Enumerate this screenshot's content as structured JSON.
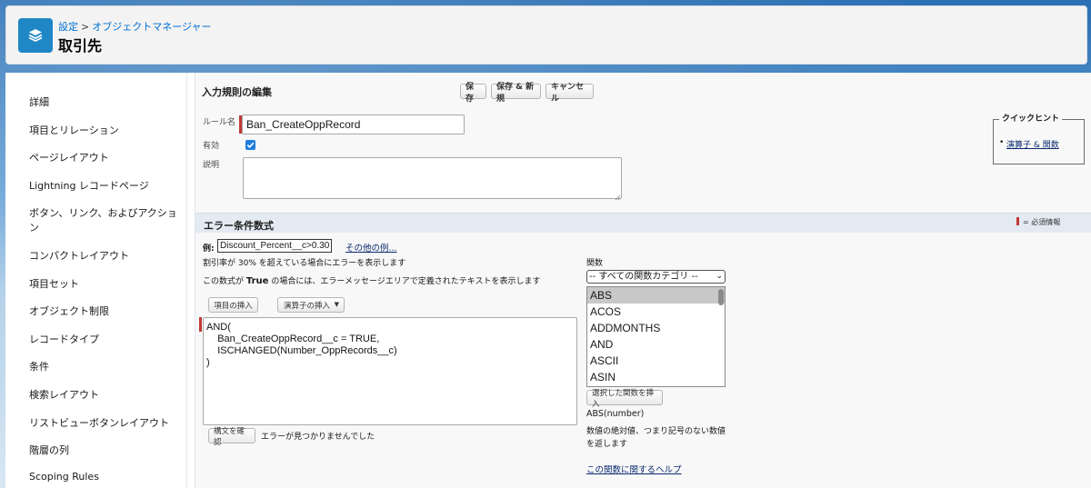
{
  "header": {
    "breadcrumb_root": "設定",
    "breadcrumb_sep": ">",
    "breadcrumb_child": "オブジェクトマネージャー",
    "title": "取引先"
  },
  "sidebar": {
    "items": [
      {
        "label": "詳細"
      },
      {
        "label": "項目とリレーション"
      },
      {
        "label": "ページレイアウト"
      },
      {
        "label": "Lightning レコードページ"
      },
      {
        "label": "ボタン、リンク、およびアクション"
      },
      {
        "label": "コンパクトレイアウト"
      },
      {
        "label": "項目セット"
      },
      {
        "label": "オブジェクト制限"
      },
      {
        "label": "レコードタイプ"
      },
      {
        "label": "条件"
      },
      {
        "label": "検索レイアウト"
      },
      {
        "label": "リストビューボタンレイアウト"
      },
      {
        "label": "階層の列"
      },
      {
        "label": "Scoping Rules"
      }
    ]
  },
  "edit": {
    "title": "入力規則の編集",
    "save": "保存",
    "save_new": "保存 & 新規",
    "cancel": "キャンセル",
    "rule_name_label": "ルール名",
    "rule_name_value": "Ban_CreateOppRecord",
    "active_label": "有効",
    "active_checked": true,
    "description_label": "説明",
    "description_value": ""
  },
  "quick_hint": {
    "title": "クイックヒント",
    "link": "演算子 & 関数"
  },
  "error_formula": {
    "title": "エラー条件数式",
    "required_note": "= 必須情報",
    "example_label": "例:",
    "example_value": "Discount_Percent__c>0.30",
    "more_examples": "その他の例...",
    "example_desc": "割引率が 30% を超えている場合にエラーを表示します",
    "desc_prefix": "この数式が",
    "desc_true": "True",
    "desc_suffix": "の場合には、エラーメッセージエリアで定義されたテキストを表示します",
    "insert_field": "項目の挿入",
    "insert_operator": "演算子の挿入",
    "formula": "AND(\n    Ban_CreateOppRecord__c = TRUE,\n    ISCHANGED(Number_OppRecords__c)\n)",
    "check_syntax": "構文を確認",
    "syntax_result": "エラーが見つかりませんでした"
  },
  "functions": {
    "label": "関数",
    "category_selected": "-- すべての関数カテゴリ --",
    "items": [
      "ABS",
      "ACOS",
      "ADDMONTHS",
      "AND",
      "ASCII",
      "ASIN"
    ],
    "insert_selected": "選択した関数を挿入",
    "signature": "ABS(number)",
    "desc_line1": "数値の絶対値、つまり記号のない数値",
    "desc_line2": "を返します",
    "help_link": "この関数に関するヘルプ"
  },
  "colors": {
    "brand": "#1f87c6",
    "link": "#0070d2",
    "required": "#c23934"
  }
}
